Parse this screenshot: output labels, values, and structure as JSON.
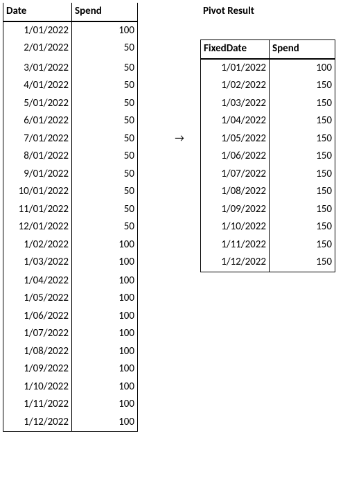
{
  "left_header": {
    "date": "Date",
    "spend": "Spend"
  },
  "left_rows": [
    {
      "date": "1/01/2022",
      "spend": "100"
    },
    {
      "date": "2/01/2022",
      "spend": "50"
    },
    {
      "date": "3/01/2022",
      "spend": "50"
    },
    {
      "date": "4/01/2022",
      "spend": "50"
    },
    {
      "date": "5/01/2022",
      "spend": "50"
    },
    {
      "date": "6/01/2022",
      "spend": "50"
    },
    {
      "date": "7/01/2022",
      "spend": "50"
    },
    {
      "date": "8/01/2022",
      "spend": "50"
    },
    {
      "date": "9/01/2022",
      "spend": "50"
    },
    {
      "date": "10/01/2022",
      "spend": "50"
    },
    {
      "date": "11/01/2022",
      "spend": "50"
    },
    {
      "date": "12/01/2022",
      "spend": "50"
    },
    {
      "date": "1/02/2022",
      "spend": "100"
    },
    {
      "date": "1/03/2022",
      "spend": "100"
    },
    {
      "date": "1/04/2022",
      "spend": "100"
    },
    {
      "date": "1/05/2022",
      "spend": "100"
    },
    {
      "date": "1/06/2022",
      "spend": "100"
    },
    {
      "date": "1/07/2022",
      "spend": "100"
    },
    {
      "date": "1/08/2022",
      "spend": "100"
    },
    {
      "date": "1/09/2022",
      "spend": "100"
    },
    {
      "date": "1/10/2022",
      "spend": "100"
    },
    {
      "date": "1/11/2022",
      "spend": "100"
    },
    {
      "date": "1/12/2022",
      "spend": "100"
    }
  ],
  "pivot_title": "Pivot Result",
  "arrow": "→",
  "right_header": {
    "date": "FixedDate",
    "spend": "Spend"
  },
  "right_rows": [
    {
      "date": "1/01/2022",
      "spend": "100"
    },
    {
      "date": "1/02/2022",
      "spend": "150"
    },
    {
      "date": "1/03/2022",
      "spend": "150"
    },
    {
      "date": "1/04/2022",
      "spend": "150"
    },
    {
      "date": "1/05/2022",
      "spend": "150"
    },
    {
      "date": "1/06/2022",
      "spend": "150"
    },
    {
      "date": "1/07/2022",
      "spend": "150"
    },
    {
      "date": "1/08/2022",
      "spend": "150"
    },
    {
      "date": "1/09/2022",
      "spend": "150"
    },
    {
      "date": "1/10/2022",
      "spend": "150"
    },
    {
      "date": "1/11/2022",
      "spend": "150"
    },
    {
      "date": "1/12/2022",
      "spend": "150"
    }
  ]
}
